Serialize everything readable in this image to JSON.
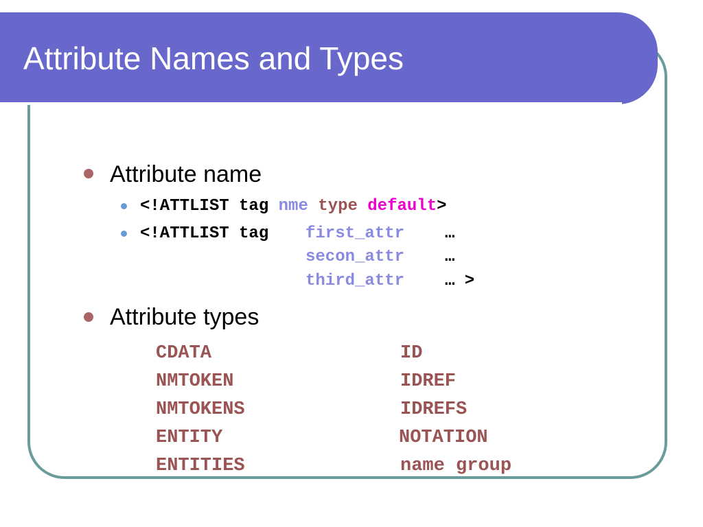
{
  "title": "Attribute Names and Types",
  "bullets": {
    "name": "Attribute name",
    "types": "Attribute types"
  },
  "line1": {
    "open": "<!ATTLIST tag",
    "name": "nme",
    "type": "type",
    "default": "default",
    "close": ">"
  },
  "line2": {
    "open": "<!ATTLIST tag",
    "a1": "first_attr",
    "a1_rest": "…",
    "a2": "secon_attr",
    "a2_rest": "…",
    "a3": "third_attr",
    "a3_rest": "… >"
  },
  "attribute_types": {
    "left": [
      "CDATA",
      "NMTOKEN",
      "NMTOKENS",
      "ENTITY",
      "ENTITIES"
    ],
    "right": [
      "ID",
      "IDREF",
      "IDREFS",
      "NOTATION",
      "name group"
    ]
  },
  "colors": {
    "title_bar": "#6868cc",
    "frame": "#6b9c9c",
    "bullet_level1": "#aa6666",
    "bullet_level2": "#6a9bd8",
    "keyword": "#9a5454",
    "attr_name": "#8a8ae0",
    "default": "#ee00cc"
  }
}
